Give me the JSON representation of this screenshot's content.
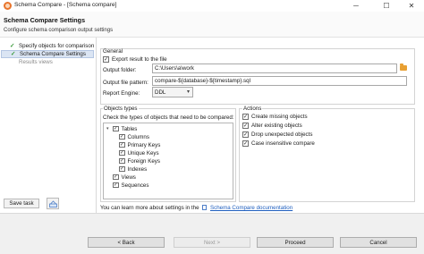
{
  "window": {
    "title": "Schema Compare - [Schema compare]",
    "controls": {
      "minimize": "─",
      "maximize": "☐",
      "close": "✕"
    }
  },
  "header": {
    "title": "Schema Compare Settings",
    "subtitle": "Configure schema comparison output settings"
  },
  "nav": {
    "items": [
      {
        "label": "Specify objects for comparison",
        "completed": true,
        "active": false
      },
      {
        "label": "Schema Compare Settings",
        "completed": true,
        "active": true
      },
      {
        "label": "Results views",
        "completed": false,
        "active": false
      }
    ],
    "save_task_label": "Save task",
    "library_icon": "library-icon"
  },
  "general": {
    "title": "General",
    "export_label": "Export result to the file",
    "export_checked": true,
    "output_folder_label": "Output folder:",
    "output_folder_value": "C:\\Users\\a\\work",
    "output_pattern_label": "Output file pattern:",
    "output_pattern_value": "compare-${database}-${timestamp}.sql",
    "engine_label": "Report Engine:",
    "engine_value": "DDL"
  },
  "object_types": {
    "title": "Objects types",
    "description": "Check the types of objects that need to be compared:",
    "tree": [
      {
        "label": "Tables",
        "checked": true,
        "level": 0,
        "expanded": true
      },
      {
        "label": "Columns",
        "checked": true,
        "level": 1
      },
      {
        "label": "Primary Keys",
        "checked": true,
        "level": 1
      },
      {
        "label": "Unique Keys",
        "checked": true,
        "level": 1
      },
      {
        "label": "Foreign Keys",
        "checked": true,
        "level": 1
      },
      {
        "label": "Indexes",
        "checked": true,
        "level": 1
      },
      {
        "label": "Views",
        "checked": true,
        "level": 0
      },
      {
        "label": "Sequences",
        "checked": true,
        "level": 0
      }
    ]
  },
  "actions": {
    "title": "Actions",
    "items": [
      {
        "label": "Create missing objects",
        "checked": true
      },
      {
        "label": "Alter existing objects",
        "checked": true
      },
      {
        "label": "Drop unexpected objects",
        "checked": true
      },
      {
        "label": "Case insensitive compare",
        "checked": true
      }
    ]
  },
  "info": {
    "text": "You can learn more about settings in the",
    "link_label": "Schema Compare documentation"
  },
  "footer": {
    "back_label": "< Back",
    "next_label": "Next >",
    "proceed_label": "Proceed",
    "cancel_label": "Cancel"
  },
  "colors": {
    "accent_link": "#1f5fbf",
    "nav_active_bg": "#dbe5f3",
    "check_green": "#3a9a3a",
    "folder_icon": "#e8a033"
  }
}
